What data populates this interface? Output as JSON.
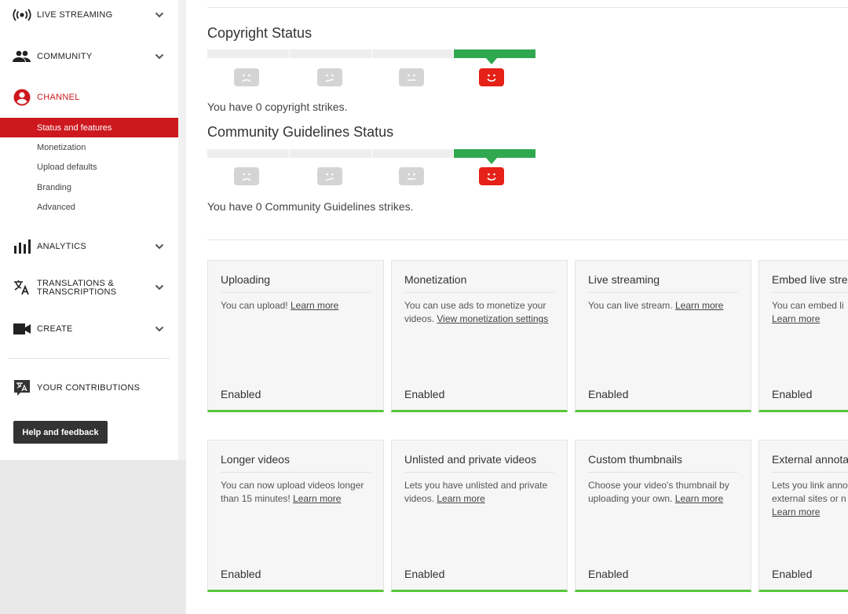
{
  "sidebar": {
    "live_streaming": "LIVE STREAMING",
    "community": "COMMUNITY",
    "channel": "CHANNEL",
    "sub_items": [
      "Status and features",
      "Monetization",
      "Upload defaults",
      "Branding",
      "Advanced"
    ],
    "analytics": "ANALYTICS",
    "translations_line1": "TRANSLATIONS &",
    "translations_line2": "TRANSCRIPTIONS",
    "create": "CREATE",
    "your_contributions": "YOUR CONTRIBUTIONS",
    "help_feedback": "Help and feedback"
  },
  "copyright": {
    "title": "Copyright Status",
    "text": "You have 0 copyright strikes."
  },
  "community_guidelines": {
    "title": "Community Guidelines Status",
    "text": "You have 0 Community Guidelines strikes."
  },
  "features": [
    {
      "title": "Uploading",
      "desc": "You can upload!",
      "link": "Learn more",
      "status": "Enabled"
    },
    {
      "title": "Monetization",
      "desc": "You can use ads to monetize your videos.",
      "link": "View monetization settings",
      "status": "Enabled"
    },
    {
      "title": "Live streaming",
      "desc": "You can live stream.",
      "link": "Learn more",
      "status": "Enabled"
    },
    {
      "title": "Embed live stre",
      "desc": "You can embed li",
      "link": "Learn more",
      "status": "Enabled"
    },
    {
      "title": "Longer videos",
      "desc": "You can now upload videos longer than 15 minutes!",
      "link": "Learn more",
      "status": "Enabled"
    },
    {
      "title": "Unlisted and private videos",
      "desc": "Lets you have unlisted and private videos.",
      "link": "Learn more",
      "status": "Enabled"
    },
    {
      "title": "Custom thumbnails",
      "desc": "Choose your video's thumbnail by uploading your own.",
      "link": "Learn more",
      "status": "Enabled"
    },
    {
      "title": "External annota",
      "desc": "Lets you link anno external sites or n",
      "link": "Learn more",
      "status": "Enabled"
    }
  ],
  "colors": {
    "accent": "#cc181e",
    "good": "#2fa84f",
    "enabled": "#58c73a"
  }
}
